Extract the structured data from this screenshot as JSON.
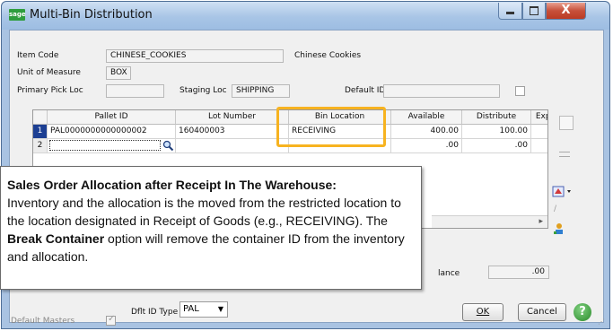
{
  "window": {
    "app_icon_text": "sage",
    "title": "Multi-Bin Distribution",
    "close_glyph": "X"
  },
  "form": {
    "item_code_label": "Item Code",
    "item_code_value": "CHINESE_COOKIES",
    "item_desc": "Chinese Cookies",
    "uom_label": "Unit of Measure",
    "uom_value": "BOX",
    "primary_pick_label": "Primary Pick Loc",
    "primary_pick_value": "",
    "staging_label": "Staging Loc",
    "staging_value": "SHIPPING",
    "default_id_label": "Default ID",
    "default_id_value": ""
  },
  "grid": {
    "columns": [
      "Pallet ID",
      "Lot Number",
      "Bin Location",
      "Available",
      "Distribute",
      "Expi"
    ],
    "rows": [
      {
        "num": "1",
        "pallet_id": "PAL0000000000000002",
        "lot": "160400003",
        "bin": "RECEIVING",
        "available": "400.00",
        "distribute": "100.00"
      },
      {
        "num": "2",
        "pallet_id": "",
        "lot": "",
        "bin": "",
        "available": ".00",
        "distribute": ".00"
      }
    ]
  },
  "balance": {
    "label": "lance",
    "value": ".00"
  },
  "callout": {
    "heading": "Sales Order Allocation after Receipt In The Warehouse:",
    "text_1": "Inventory and the allocation is the moved from the restricted location to the location designated in Receipt of Goods (e.g., RECEIVING).  The ",
    "bold": "Break Container",
    "text_2": " option will remove the container ID from the inventory and allocation."
  },
  "bottom": {
    "default_masters_label": "Default Masters",
    "dflt_id_type_label": "Dflt ID Type",
    "dflt_id_type_value": "PAL",
    "ok_label": "OK",
    "cancel_label": "Cancel",
    "help_glyph": "?"
  },
  "colors": {
    "highlight": "#f7b320",
    "selected_row": "#1d3f93",
    "title_bar": "#a9c3e2"
  }
}
